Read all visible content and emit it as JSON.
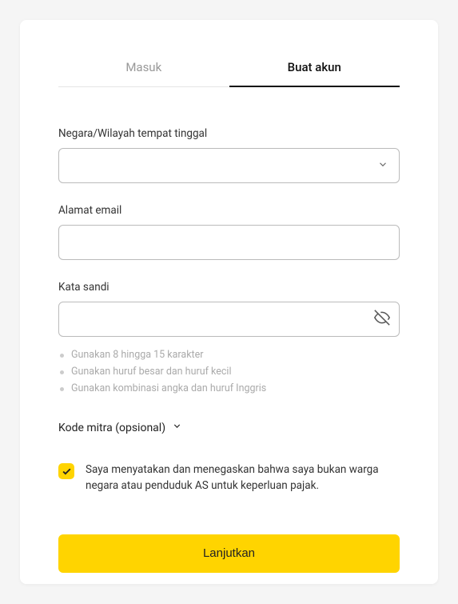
{
  "tabs": {
    "login": "Masuk",
    "signup": "Buat akun"
  },
  "country": {
    "label": "Negara/Wilayah tempat tinggal"
  },
  "email": {
    "label": "Alamat email"
  },
  "password": {
    "label": "Kata sandi",
    "hints": [
      "Gunakan 8 hingga 15 karakter",
      "Gunakan huruf besar dan huruf kecil",
      "Gunakan kombinasi angka dan huruf Inggris"
    ]
  },
  "partner": {
    "label": "Kode mitra (opsional)"
  },
  "consent": {
    "checked": true,
    "text": "Saya menyatakan dan menegaskan bahwa saya bukan warga negara atau penduduk AS untuk keperluan pajak."
  },
  "submit": {
    "label": "Lanjutkan"
  }
}
